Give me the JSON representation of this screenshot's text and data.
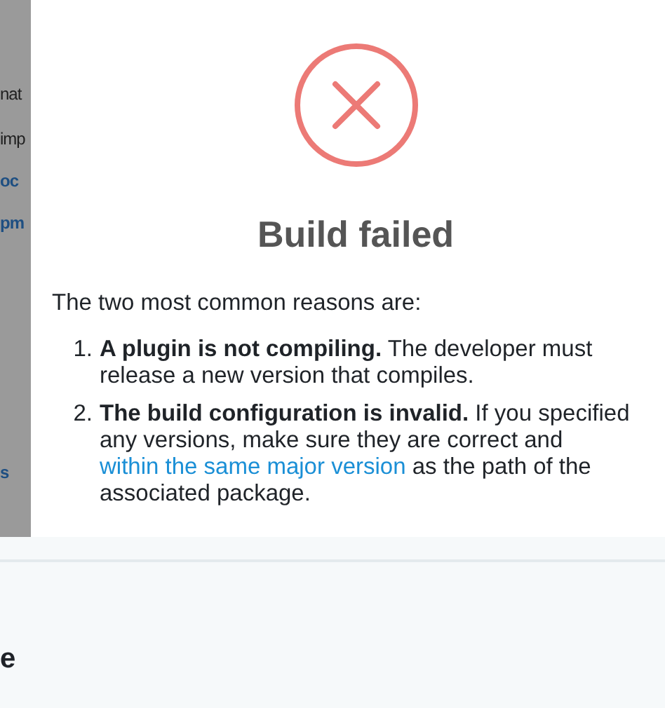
{
  "background_page": {
    "side_texts": [
      {
        "text": "nat",
        "kind": "plain"
      },
      {
        "text": "imp",
        "kind": "plain"
      },
      {
        "text": "oc",
        "kind": "link"
      },
      {
        "text": "pm",
        "kind": "link"
      },
      {
        "text": "s",
        "kind": "link"
      }
    ],
    "footer_heading": "e"
  },
  "modal": {
    "title": "Build failed",
    "intro": "The two most common reasons are:",
    "reasons": [
      {
        "number": "1.",
        "text": "**A plugin is not compiling.** The developer must release a new version that compiles."
      },
      {
        "number": "2.",
        "text": "**The build configuration is invalid.** If you specified any versions, make sure they are correct and",
        "link": "within the same major version",
        "after": "as the path of the associated package."
      }
    ]
  }
}
